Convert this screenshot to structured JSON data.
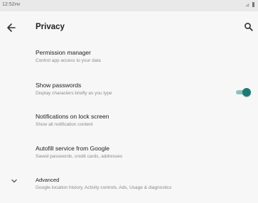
{
  "status_bar": {
    "time": "12:52",
    "ampm": "PM",
    "signal_icon": "signal-icon",
    "battery_icon": "battery-icon"
  },
  "app_bar": {
    "title": "Privacy",
    "back_icon": "arrow-back-icon",
    "search_icon": "search-icon"
  },
  "settings": [
    {
      "title": "Permission manager",
      "summary": "Control app access to your data"
    },
    {
      "title": "Show passwords",
      "summary": "Display characters briefly as you type",
      "toggle_on": true
    },
    {
      "title": "Notifications on lock screen",
      "summary": "Show all notification content"
    },
    {
      "title": "Autofill service from Google",
      "summary": "Saved passwords, credit cards, addresses"
    },
    {
      "title": "Advanced",
      "summary": "Google location history, Activity controls, Ads, Usage & diagnostics",
      "icon": "chevron-down-icon"
    }
  ],
  "colors": {
    "accent": "#1a7b72",
    "track": "#8ac3bd",
    "background": "#f7f7f7",
    "title_text": "#202124",
    "summary_text": "#8a8a8a"
  }
}
